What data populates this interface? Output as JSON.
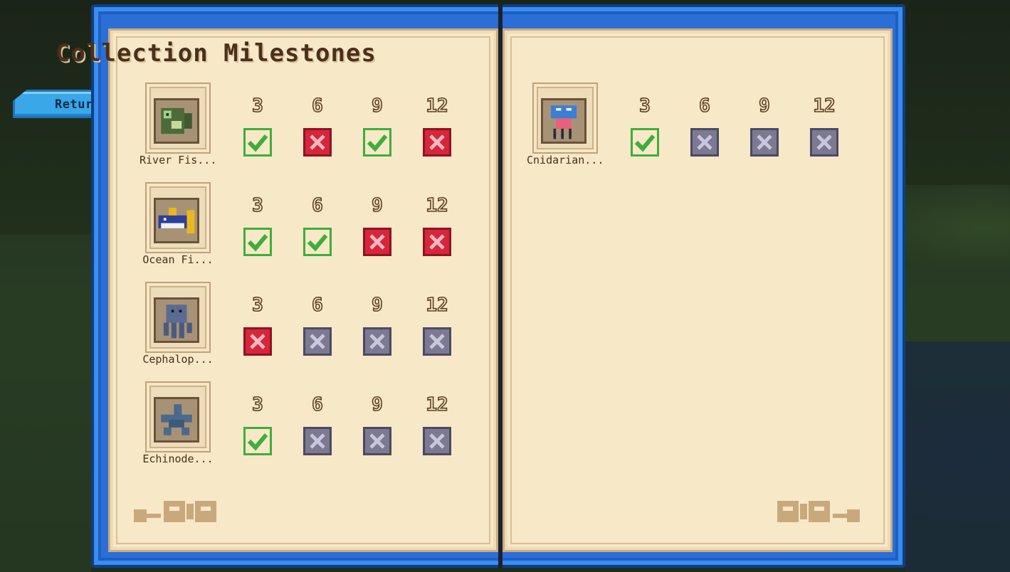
{
  "return_button": {
    "label": "Return"
  },
  "title": "Collection Milestones",
  "milestone_thresholds": [
    "3",
    "6",
    "9",
    "12"
  ],
  "collections": [
    {
      "name": "River Fis...",
      "icon": "river-fish-icon",
      "status": [
        "done",
        "fail",
        "done",
        "fail"
      ]
    },
    {
      "name": "Ocean Fi...",
      "icon": "ocean-fish-icon",
      "status": [
        "done",
        "done",
        "fail",
        "fail"
      ]
    },
    {
      "name": "Cephalop...",
      "icon": "cephalopod-icon",
      "status": [
        "fail",
        "locked",
        "locked",
        "locked"
      ]
    },
    {
      "name": "Echinode...",
      "icon": "echinoderm-icon",
      "status": [
        "done",
        "locked",
        "locked",
        "locked"
      ]
    },
    {
      "name": "Cnidarian...",
      "icon": "cnidarian-icon",
      "status": [
        "done",
        "locked",
        "locked",
        "locked"
      ]
    }
  ],
  "colors": {
    "book_blue": "#2a6ed6",
    "page": "#f7e8c8",
    "done": "#3fae3a",
    "fail": "#d6263a",
    "locked": "#7c7a92"
  }
}
